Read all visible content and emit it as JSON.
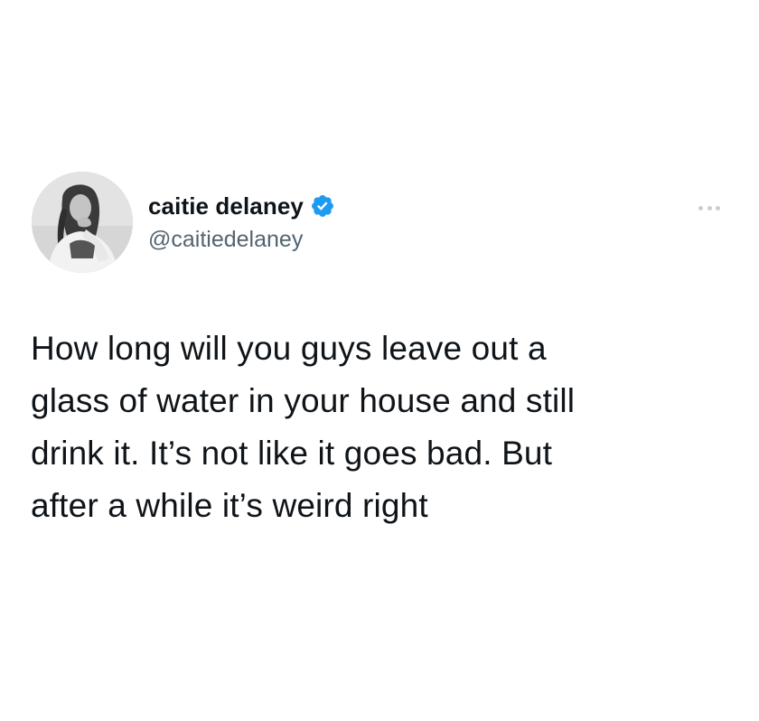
{
  "tweet": {
    "author": {
      "display_name": "caitie delaney",
      "handle": "@caitiedelaney",
      "verified": true,
      "avatar": "profile-photo-grayscale"
    },
    "more_icon": "more-horizontal-icon",
    "text_lines": [
      "How long will you guys leave out a",
      "glass of water in your house and still",
      "drink it. It’s not like it goes bad. But",
      "after a while it’s weird right"
    ]
  },
  "colors": {
    "text": "#0f1419",
    "secondary_text": "#536471",
    "verified_blue": "#1d9bf0",
    "background": "#ffffff"
  }
}
